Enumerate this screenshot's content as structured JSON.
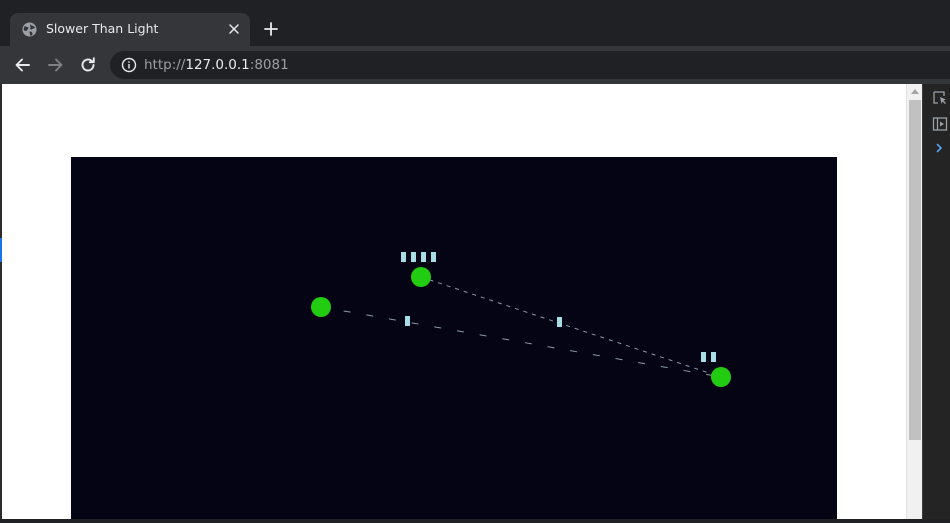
{
  "browser": {
    "tab": {
      "title": "Slower Than Light",
      "icon": "globe-icon"
    },
    "url": {
      "scheme": "http://",
      "host": "127.0.0.1",
      "port": ":8081"
    }
  },
  "game": {
    "background": "#050414",
    "planet_color": "#22cc11",
    "ship_color": "#a8dce6",
    "route_color": "#8a9aa8",
    "planets": [
      {
        "id": "planet-west"
      },
      {
        "id": "planet-north",
        "ships": 4
      },
      {
        "id": "planet-east",
        "ships": 2
      }
    ],
    "fleets_in_transit": [
      {
        "route": "planet-west to planet-east",
        "ships": 1
      },
      {
        "route": "planet-north to planet-east",
        "ships": 1
      }
    ]
  }
}
